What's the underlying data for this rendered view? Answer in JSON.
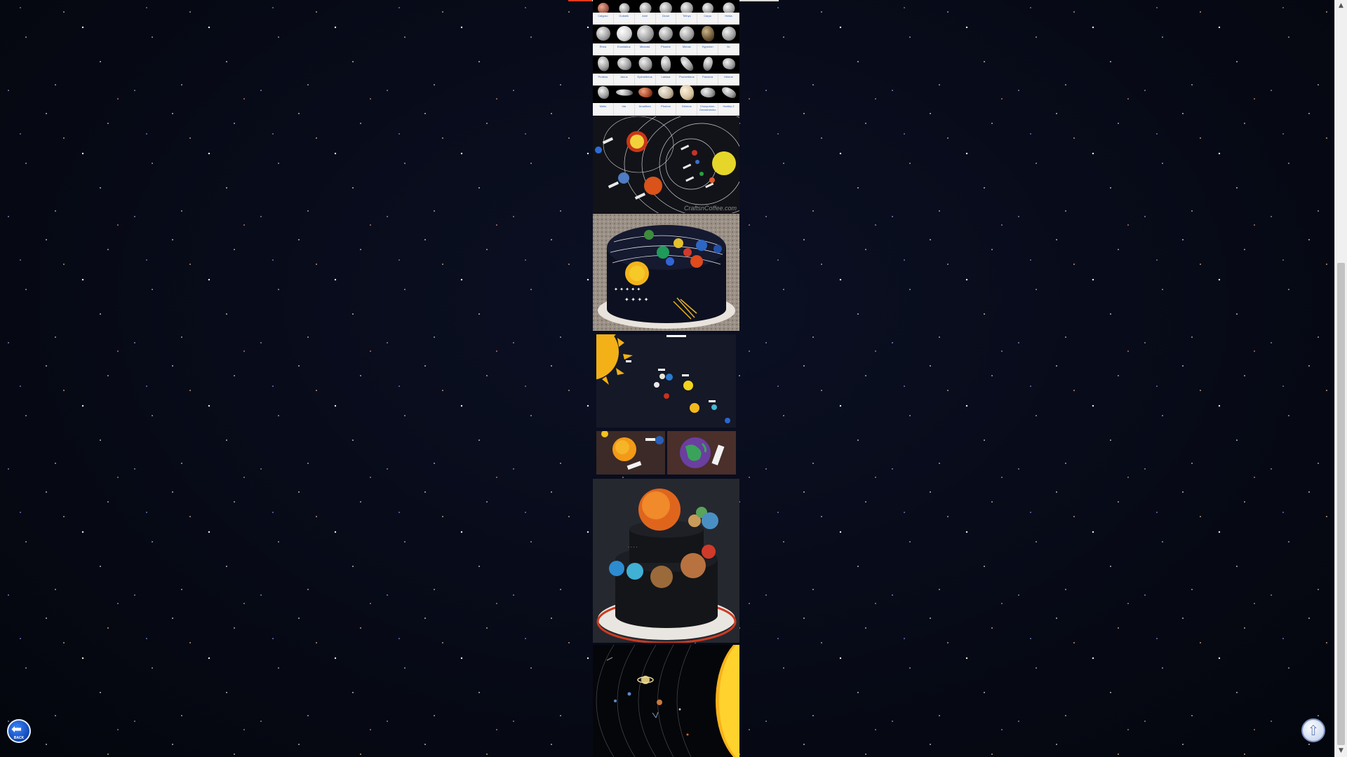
{
  "page": {
    "background": "starfield",
    "accent": "#e03a1e"
  },
  "moon_chart": {
    "rows": [
      {
        "labels": [
          "Calypso",
          "Gutstek",
          "Ariel",
          "Dione",
          "Tethys",
          "Carpo",
          "Hekla"
        ]
      },
      {
        "labels": [
          "Rhea",
          "Enceladus",
          "Miranda",
          "Phoebe",
          "Mimas",
          "Hyperion",
          "Ilo"
        ]
      },
      {
        "labels": [
          "Proteus",
          "Janus",
          "Epimetheus",
          "Larissa",
          "Prometheus",
          "Pandora",
          "Helene"
        ]
      },
      {
        "labels": [
          "Metis",
          "Ida",
          "Amalthea",
          "Phobos",
          "Deimos",
          "Churyumov-Gerasimenko",
          "Hartley 2"
        ]
      }
    ]
  },
  "images": {
    "orbits_model": {
      "alt": "solar system orbit model",
      "watermark": "CraftsnCoffee.com"
    },
    "cake_one": {
      "alt": "solar system cake"
    },
    "wall_model": {
      "alt": "solar system wall display"
    },
    "detail_left": {
      "alt": "planet detail"
    },
    "detail_right": {
      "alt": "earth detail"
    },
    "cake_two": {
      "alt": "planet tier cake"
    },
    "sun_diagram": {
      "alt": "solar system diagram"
    }
  },
  "controls": {
    "back_label": "BACK",
    "back_icon": "back-arrow-icon",
    "top_icon": "up-arrow-icon"
  },
  "scrollbar": {
    "position_fraction": 0.35
  }
}
